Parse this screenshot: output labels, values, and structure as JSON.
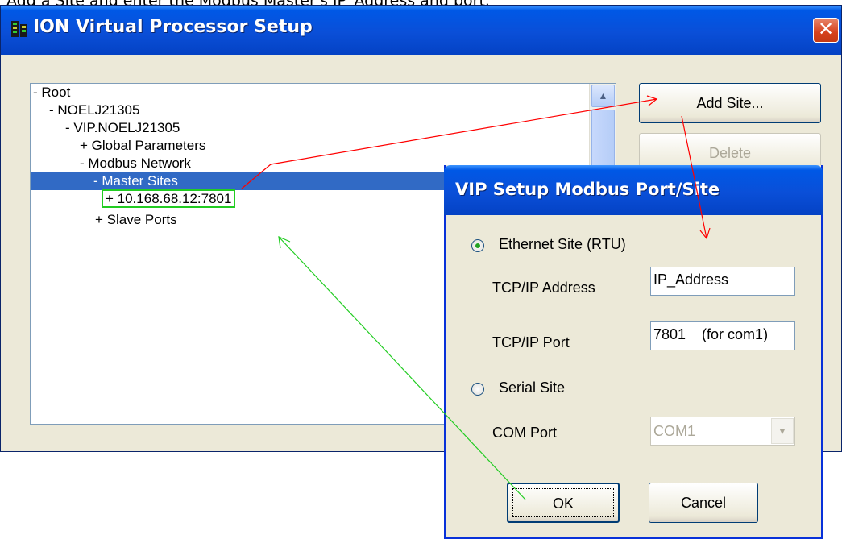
{
  "caption": "Add a Site and enter the Modbus Master's IP_Address and port.",
  "main_window": {
    "title": "ION Virtual Processor Setup",
    "close_glyph": "✕",
    "tree": [
      {
        "label": "- Root"
      },
      {
        "label": "- NOELJ21305"
      },
      {
        "label": "- VIP.NOELJ21305"
      },
      {
        "label": "+ Global Parameters"
      },
      {
        "label": "- Modbus Network"
      },
      {
        "label": "- Master Sites"
      },
      {
        "label": "+ 10.168.68.12:7801"
      },
      {
        "label": "+ Slave Ports"
      }
    ],
    "buttons": {
      "add_site": "Add Site...",
      "delete": "Delete"
    }
  },
  "dialog": {
    "title": "VIP Setup Modbus Port/Site",
    "ethernet_label": "Ethernet Site (RTU)",
    "tcp_ip_address_label": "TCP/IP Address",
    "tcp_ip_address_value": "IP_Address",
    "tcp_ip_port_label": "TCP/IP Port",
    "tcp_ip_port_value": "7801    (for com1)",
    "serial_label": "Serial Site",
    "com_port_label": "COM Port",
    "com_port_value": "COM1",
    "ok_label": "OK",
    "cancel_label": "Cancel",
    "selected_site_type": "Ethernet Site (RTU)"
  },
  "icons": [
    "window-app-icon",
    "close-icon",
    "scroll-up-icon",
    "dropdown-arrow-icon"
  ],
  "colors": {
    "title_bar": "#0a4fd8",
    "selection": "#316ac5",
    "annotation_red": "#ff0000",
    "annotation_green": "#22cc22"
  }
}
